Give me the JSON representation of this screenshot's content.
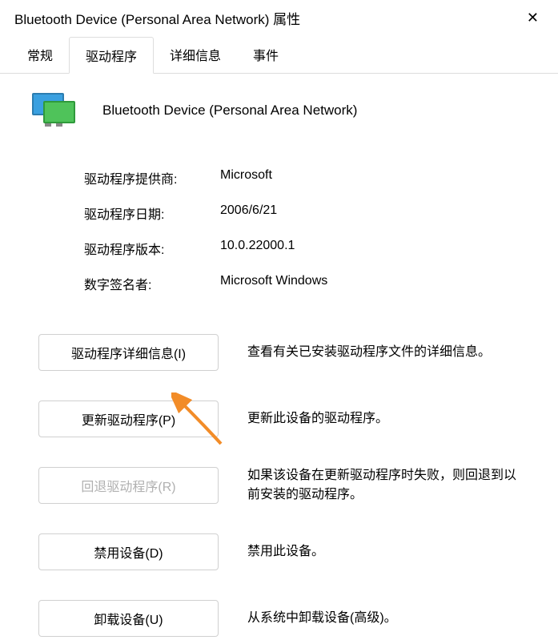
{
  "titlebar": {
    "title": "Bluetooth Device (Personal Area Network) 属性"
  },
  "tabs": {
    "general": "常规",
    "driver": "驱动程序",
    "details": "详细信息",
    "events": "事件"
  },
  "header": {
    "device_name": "Bluetooth Device (Personal Area Network)"
  },
  "info": {
    "provider_label": "驱动程序提供商:",
    "provider_value": "Microsoft",
    "date_label": "驱动程序日期:",
    "date_value": "2006/6/21",
    "version_label": "驱动程序版本:",
    "version_value": "10.0.22000.1",
    "signer_label": "数字签名者:",
    "signer_value": "Microsoft Windows"
  },
  "actions": {
    "details_btn": "驱动程序详细信息(I)",
    "details_desc": "查看有关已安装驱动程序文件的详细信息。",
    "update_btn": "更新驱动程序(P)",
    "update_desc": "更新此设备的驱动程序。",
    "rollback_btn": "回退驱动程序(R)",
    "rollback_desc": "如果该设备在更新驱动程序时失败，则回退到以前安装的驱动程序。",
    "disable_btn": "禁用设备(D)",
    "disable_desc": "禁用此设备。",
    "uninstall_btn": "卸载设备(U)",
    "uninstall_desc": "从系统中卸载设备(高级)。"
  }
}
